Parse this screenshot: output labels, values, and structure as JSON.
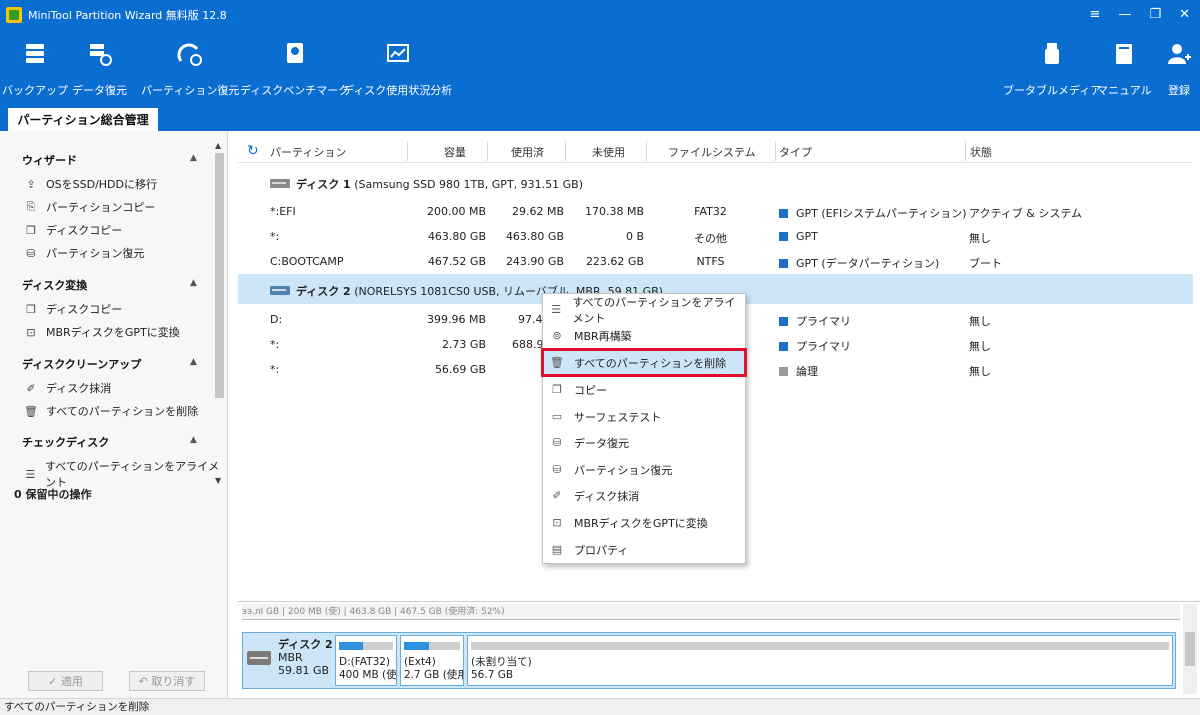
{
  "window": {
    "title": "MiniTool Partition Wizard 無料版 12.8",
    "controls": [
      "≡",
      "—",
      "❐",
      "✕"
    ]
  },
  "toolbar": {
    "left": [
      {
        "label": "バックアップ",
        "icon": "backup-icon"
      },
      {
        "label": "データ復元",
        "icon": "data-recovery-icon"
      },
      {
        "label": "パーティション復元",
        "icon": "partition-recovery-icon"
      },
      {
        "label": "ディスクベンチマーク",
        "icon": "disk-benchmark-icon"
      },
      {
        "label": "ディスク使用状況分析",
        "icon": "space-analyzer-icon"
      }
    ],
    "right": [
      {
        "label": "ブータブルメディア",
        "icon": "bootable-media-icon"
      },
      {
        "label": "マニュアル",
        "icon": "manual-icon"
      },
      {
        "label": "登録",
        "icon": "register-icon"
      }
    ]
  },
  "main_tab": "パーティション総合管理",
  "sidebar": {
    "sections": [
      {
        "title": "ウィザード",
        "items": [
          {
            "label": "OSをSSD/HDDに移行",
            "icon": "migrate-os-icon"
          },
          {
            "label": "パーティションコピー",
            "icon": "copy-partition-icon"
          },
          {
            "label": "ディスクコピー",
            "icon": "copy-disk-icon"
          },
          {
            "label": "パーティション復元",
            "icon": "partition-recovery-icon"
          }
        ]
      },
      {
        "title": "ディスク変換",
        "items": [
          {
            "label": "ディスクコピー",
            "icon": "copy-disk-icon"
          },
          {
            "label": "MBRディスクをGPTに変換",
            "icon": "convert-icon"
          }
        ]
      },
      {
        "title": "ディスククリーンアップ",
        "items": [
          {
            "label": "ディスク抹消",
            "icon": "eraser-icon"
          },
          {
            "label": "すべてのパーティションを削除",
            "icon": "trash-icon"
          }
        ]
      },
      {
        "title": "チェックディスク",
        "items": [
          {
            "label": "すべてのパーティションをアライメント",
            "icon": "align-icon"
          }
        ]
      }
    ],
    "pending": "0 保留中の操作",
    "apply": "✓ 適用",
    "undo": "↶ 取り消す"
  },
  "table": {
    "headers": [
      "パーティション",
      "容量",
      "使用済",
      "未使用",
      "ファイルシステム",
      "タイプ",
      "状態"
    ],
    "disk1": {
      "name": "ディスク 1",
      "detail": "(Samsung SSD 980 1TB, GPT, 931.51 GB)"
    },
    "disk1_rows": [
      {
        "partition": "*:EFI",
        "capacity": "200.00 MB",
        "used": "29.62 MB",
        "unused": "170.38 MB",
        "fs": "FAT32",
        "type": "GPT (EFIシステムパーティション)",
        "status": "アクティブ & システム"
      },
      {
        "partition": "*:",
        "capacity": "463.80 GB",
        "used": "463.80 GB",
        "unused": "0 B",
        "fs": "その他",
        "type": "GPT",
        "status": "無し"
      },
      {
        "partition": "C:BOOTCAMP",
        "capacity": "467.52 GB",
        "used": "243.90 GB",
        "unused": "223.62 GB",
        "fs": "NTFS",
        "type": "GPT (データパーティション)",
        "status": "ブート"
      }
    ],
    "disk2": {
      "name": "ディスク 2",
      "detail": "(NORELSYS 1081CS0 USB, リムーバブル, MBR, 59.81 GB)"
    },
    "disk2_rows": [
      {
        "partition": "D:",
        "capacity": "399.96 MB",
        "used": "97.46",
        "type": "プライマリ",
        "status": "無し"
      },
      {
        "partition": "*:",
        "capacity": "2.73 GB",
        "used": "688.90",
        "type": "プライマリ",
        "status": "無し"
      },
      {
        "partition": "*:",
        "capacity": "56.69 GB",
        "used": "",
        "type": "論理",
        "status": "無し"
      }
    ]
  },
  "context_menu": [
    {
      "label": "すべてのパーティションをアライメント",
      "icon": "align-icon"
    },
    {
      "label": "MBR再構築",
      "icon": "rebuild-mbr-icon"
    },
    {
      "label": "すべてのパーティションを削除",
      "icon": "trash-icon"
    },
    {
      "label": "コピー",
      "icon": "copy-icon"
    },
    {
      "label": "サーフェステスト",
      "icon": "surface-test-icon"
    },
    {
      "label": "データ復元",
      "icon": "data-recovery-icon"
    },
    {
      "label": "パーティション復元",
      "icon": "partition-recovery-icon"
    },
    {
      "label": "ディスク抹消",
      "icon": "eraser-icon"
    },
    {
      "label": "MBRディスクをGPTに変換",
      "icon": "convert-icon"
    },
    {
      "label": "プロパティ",
      "icon": "properties-icon"
    }
  ],
  "disk_map": {
    "prev_row_text": "ээ.лI GB  | 200 MB (使)  | 463.8 GB                                                                        | 467.5 GB (使用済: 52%)",
    "disk": {
      "name": "ディスク 2",
      "scheme": "MBR",
      "size": "59.81 GB"
    },
    "parts": [
      {
        "label": "D:(FAT32)",
        "size": "400 MB (使用",
        "fill": 0.45
      },
      {
        "label": "(Ext4)",
        "size": "2.7 GB (使用",
        "fill": 0.45
      },
      {
        "label": "(未割り当て)",
        "size": "56.7 GB",
        "fill": 0
      }
    ]
  },
  "status_bar": "すべてのパーティションを削除",
  "colors": {
    "brand_blue": "#0a6ed1",
    "selection": "#cde6f7",
    "highlight_border": "#e3102d",
    "bar_fill": "#2f8fe0",
    "type_square": "#1e6fc8"
  }
}
